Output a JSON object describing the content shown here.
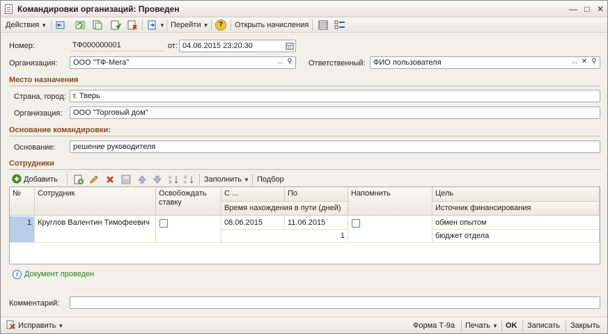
{
  "window": {
    "title": "Командировки организаций: Проведен"
  },
  "toolbar": {
    "actions_label": "Действия",
    "goto_label": "Перейти",
    "help_label": "?",
    "open_accruals_label": "Открыть начисления"
  },
  "header": {
    "number_label": "Номер:",
    "number_value": "ТФ000000001",
    "date_label": "от:",
    "date_value": "04.06.2015 23:20:30",
    "org_label": "Организация:",
    "org_value": "ООО \"ТФ-Мега\"",
    "responsible_label": "Ответственный:",
    "responsible_value": "ФИО пользователя"
  },
  "destination": {
    "section_title": "Место назначения",
    "city_label": "Страна, город:",
    "city_value": "г. Тверь",
    "org_label": "Организация:",
    "org_value": "ООО \"Торговый дом\""
  },
  "basis": {
    "section_title": "Основание командировки:",
    "basis_label": "Основание:",
    "basis_value": "решение руководителя"
  },
  "employees": {
    "section_title": "Сотрудники",
    "add_label": "Добавить",
    "fill_label": "Заполнить",
    "select_label": "Подбор",
    "columns": {
      "num": "№",
      "employee": "Сотрудник",
      "release": "Освобождать ставку",
      "from": "С ...",
      "to": "По",
      "travel_time": "Время нахождения в пути (дней)",
      "remind": "Напомнить",
      "purpose": "Цель",
      "funding": "Источник финансирования"
    },
    "rows": [
      {
        "num": "1",
        "employee": "Круглов Валентин Тимофеевич",
        "from": "08.06.2015",
        "to": "11.06.2015",
        "travel_days": "1",
        "purpose": "обмен опытом",
        "funding": "бюджет отдела"
      }
    ]
  },
  "status": {
    "text": "Документ проведен",
    "color": "#2e7d1c"
  },
  "comment": {
    "label": "Комментарий:",
    "value": ""
  },
  "bottom": {
    "fix_label": "Исправить",
    "form_label": "Форма Т-9а",
    "print_label": "Печать",
    "ok_label": "OK",
    "save_label": "Записать",
    "close_label": "Закрыть"
  }
}
